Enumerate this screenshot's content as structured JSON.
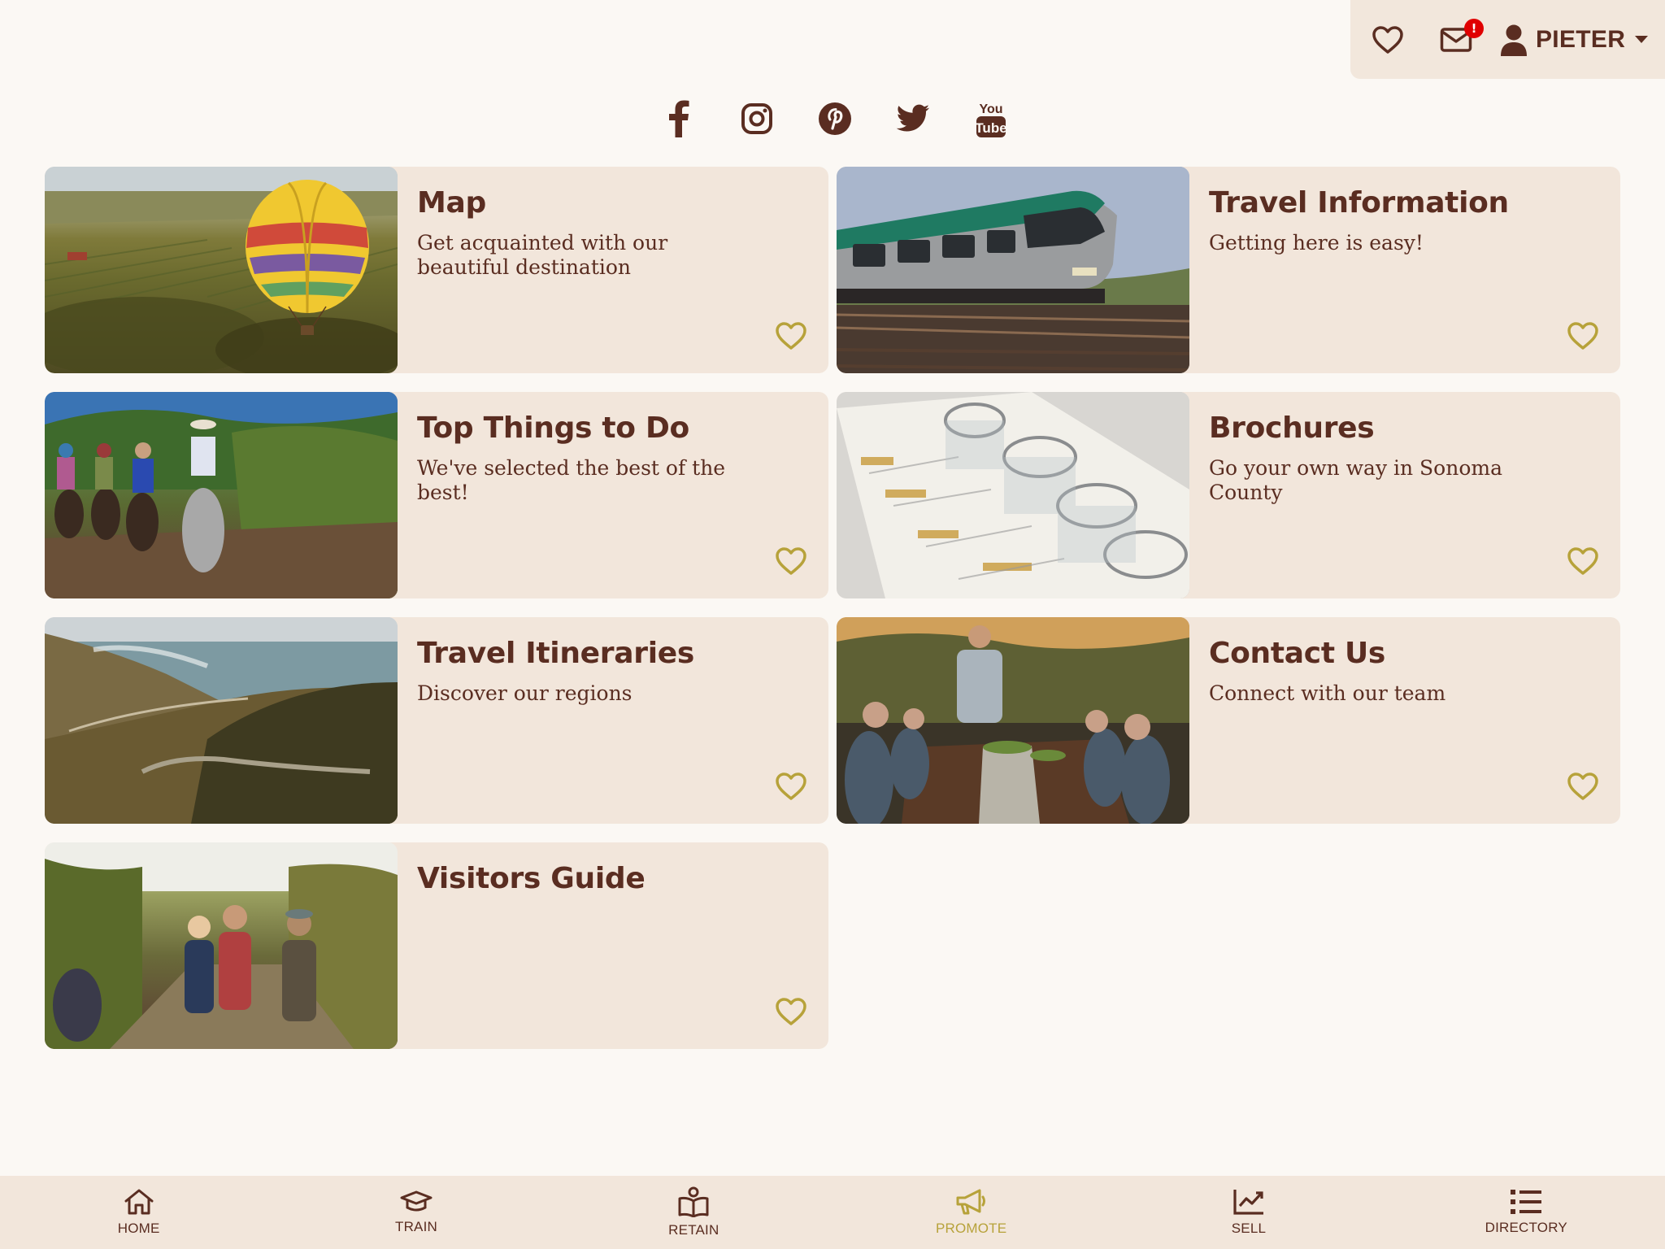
{
  "colors": {
    "brand_brown": "#5a2d21",
    "card_bg": "#f2e6db",
    "page_bg": "#fbf8f4",
    "accent_gold": "#b7a23a",
    "badge_red": "#e00000"
  },
  "user_bar": {
    "favorites_icon": "heart-icon",
    "mail_icon": "envelope-icon",
    "mail_badge": "!",
    "user_icon": "user-icon",
    "user_name": "PIETER",
    "caret_icon": "caret-down-icon"
  },
  "social": [
    {
      "name": "facebook",
      "icon": "facebook-icon"
    },
    {
      "name": "instagram",
      "icon": "instagram-icon"
    },
    {
      "name": "pinterest",
      "icon": "pinterest-icon"
    },
    {
      "name": "twitter",
      "icon": "twitter-icon"
    },
    {
      "name": "youtube",
      "icon": "youtube-icon",
      "label_top": "You",
      "label_bottom": "Tube"
    }
  ],
  "cards": [
    {
      "title": "Map",
      "description": "Get acquainted with our beautiful destination",
      "image": "hot-air-balloon-over-vineyards"
    },
    {
      "title": "Travel Information",
      "description": "Getting here is easy!",
      "image": "green-train"
    },
    {
      "title": "Top Things to Do",
      "description": "We've selected the best of the best!",
      "image": "horseback-riders-in-vineyard"
    },
    {
      "title": "Brochures",
      "description": "Go your own way in Sonoma County",
      "image": "wine-tasting-glasses"
    },
    {
      "title": "Travel Itineraries",
      "description": "Discover our regions",
      "image": "coastal-road"
    },
    {
      "title": "Contact Us",
      "description": "Connect with our team",
      "image": "outdoor-dinner-party"
    },
    {
      "title": "Visitors Guide",
      "description": "",
      "image": "friends-in-vineyard"
    }
  ],
  "bottom_nav": [
    {
      "label": "HOME",
      "icon": "home-icon",
      "active": false
    },
    {
      "label": "TRAIN",
      "icon": "graduation-cap-icon",
      "active": false
    },
    {
      "label": "RETAIN",
      "icon": "book-reader-icon",
      "active": false
    },
    {
      "label": "PROMOTE",
      "icon": "megaphone-icon",
      "active": true
    },
    {
      "label": "SELL",
      "icon": "chart-line-icon",
      "active": false
    },
    {
      "label": "DIRECTORY",
      "icon": "list-icon",
      "active": false
    }
  ]
}
